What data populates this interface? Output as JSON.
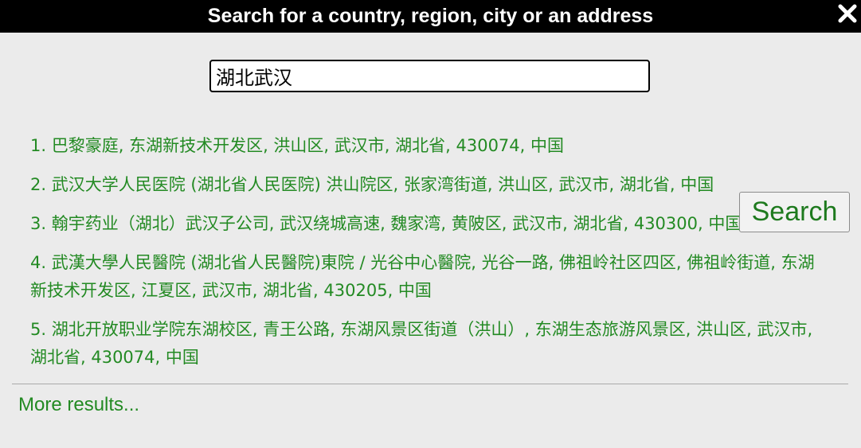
{
  "title": "Search for a country, region, city or an address",
  "search": {
    "value": "湖北武汉",
    "button_label": "Search"
  },
  "results": [
    {
      "num": "1.",
      "text": "巴黎豪庭, 东湖新技术开发区, 洪山区, 武汉市, 湖北省, 430074, 中国"
    },
    {
      "num": "2.",
      "text": "武汉大学人民医院 (湖北省人民医院) 洪山院区, 张家湾街道, 洪山区, 武汉市, 湖北省, 中国"
    },
    {
      "num": "3.",
      "text": "翰宇药业（湖北）武汉子公司, 武汉绕城高速, 魏家湾, 黄陂区, 武汉市, 湖北省, 430300, 中国"
    },
    {
      "num": "4.",
      "text": "武漢大學人民醫院 (湖北省人民醫院)東院 / 光谷中心醫院, 光谷一路, 佛祖岭社区四区, 佛祖岭街道, 东湖新技术开发区, 江夏区, 武汉市, 湖北省, 430205, 中国"
    },
    {
      "num": "5.",
      "text": "湖北开放职业学院东湖校区, 青王公路, 东湖风景区街道（洪山）, 东湖生态旅游风景区, 洪山区, 武汉市, 湖北省, 430074, 中国"
    }
  ],
  "more_results_label": "More results...",
  "colors": {
    "title_bg": "#000000",
    "background": "#ebebeb",
    "link_green": "#238a23"
  },
  "icons": {
    "close": "close-icon"
  }
}
